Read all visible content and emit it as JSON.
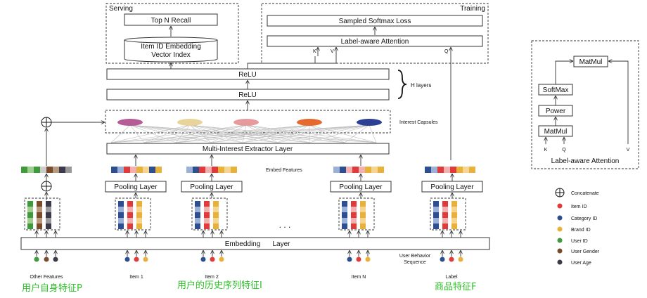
{
  "serving": {
    "label": "Serving",
    "top_n": "Top N Recall",
    "index_line1": "Item ID Embedding",
    "index_line2": "Vector Index"
  },
  "training": {
    "label": "Training",
    "loss": "Sampled Softmax Loss",
    "attention": "Label-aware Attention",
    "k": "K",
    "v": "V",
    "q": "Q"
  },
  "h_layers": {
    "relu_top": "ReLU",
    "relu_bottom": "ReLU",
    "label": "H layers"
  },
  "capsules": {
    "label": "Interest Capsules",
    "colors": [
      "#b45b98",
      "#e8d49a",
      "#e79a9c",
      "#e66a2e",
      "#2d3f94"
    ]
  },
  "extractor": "Multi-Interest Extractor Layer",
  "embed_features": "Embed Features",
  "pooling": [
    "Pooling Layer",
    "Pooling Layer",
    "Pooling Layer",
    "Pooling Layer"
  ],
  "embedding_layer": {
    "word1": "Embedding",
    "word2": "Layer"
  },
  "ellipsis": ". . .",
  "behavior_label": {
    "line1": "User Behavior",
    "line2": "Sequence"
  },
  "inputs": [
    "Other Features",
    "Item 1",
    "Item 2",
    "Item N",
    "Label"
  ],
  "chinese_labels": [
    "用户自身特征P",
    "用户的历史序列特征I",
    "商品特征F"
  ],
  "legend": [
    {
      "label": "Concatenate",
      "symbol": "circle-plus-icon"
    },
    {
      "label": "Item ID",
      "color": "#e03a3a"
    },
    {
      "label": "Category ID",
      "color": "#2d4f8f"
    },
    {
      "label": "Brand ID",
      "color": "#e8b23a"
    },
    {
      "label": "User ID",
      "color": "#3f9a3a"
    },
    {
      "label": "User Gender",
      "color": "#7a4a2a"
    },
    {
      "label": "User Age",
      "color": "#3a3a4a"
    }
  ],
  "side_attention": {
    "matmul_top": "MatMul",
    "softmax": "SoftMax",
    "power": "Power",
    "matmul_bottom": "MatMul",
    "k": "K",
    "q": "Q",
    "v": "V",
    "caption": "Label-aware Attention"
  }
}
